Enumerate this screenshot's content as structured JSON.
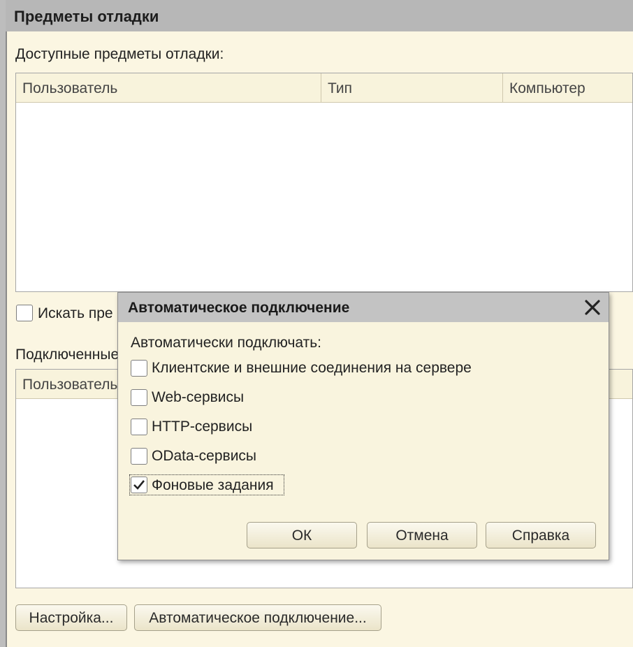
{
  "main_window": {
    "title": "Предметы отладки",
    "available_label": "Доступные предметы отладки:",
    "available_columns": [
      "Пользователь",
      "Тип",
      "Компьютер"
    ],
    "search_checkbox_label": "Искать пре",
    "connected_label": "Подключенные",
    "connected_columns": [
      "Пользователь"
    ],
    "buttons": {
      "settings": "Настройка...",
      "auto_connect": "Автоматическое подключение..."
    }
  },
  "dialog": {
    "title": "Автоматическое подключение",
    "close_icon": "close-icon",
    "prompt": "Автоматически подключать:",
    "options": [
      {
        "label": "Клиентские и внешние соединения на сервере",
        "checked": false
      },
      {
        "label": "Web-сервисы",
        "checked": false
      },
      {
        "label": "HTTP-сервисы",
        "checked": false
      },
      {
        "label": "OData-сервисы",
        "checked": false
      },
      {
        "label": "Фоновые задания",
        "checked": true
      }
    ],
    "buttons": {
      "ok": "ОК",
      "cancel": "Отмена",
      "help": "Справка"
    }
  }
}
